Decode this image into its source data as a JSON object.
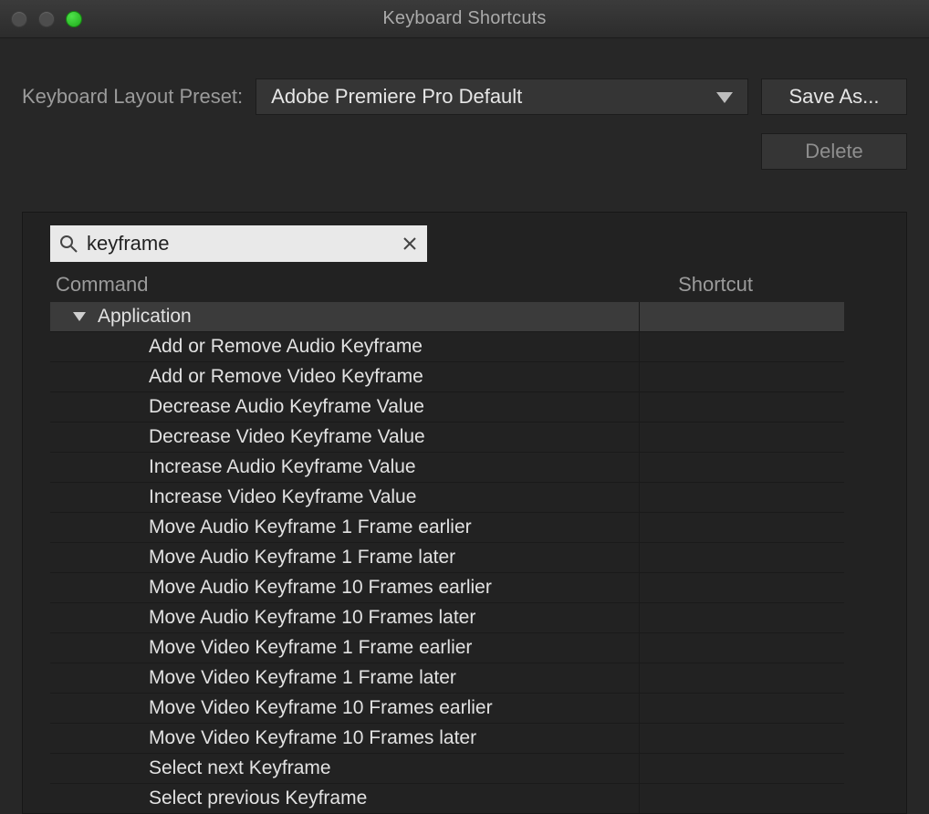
{
  "window": {
    "title": "Keyboard Shortcuts"
  },
  "preset": {
    "label": "Keyboard Layout Preset:",
    "value": "Adobe Premiere Pro Default",
    "save_as": "Save As...",
    "delete": "Delete"
  },
  "search": {
    "value": "keyframe"
  },
  "headers": {
    "command": "Command",
    "shortcut": "Shortcut"
  },
  "table": {
    "group": "Application",
    "items": [
      "Add or Remove Audio Keyframe",
      "Add or Remove Video Keyframe",
      "Decrease Audio Keyframe Value",
      "Decrease Video Keyframe Value",
      "Increase Audio Keyframe Value",
      "Increase Video Keyframe Value",
      "Move Audio Keyframe 1 Frame earlier",
      "Move Audio Keyframe 1 Frame later",
      "Move Audio Keyframe 10 Frames earlier",
      "Move Audio Keyframe 10 Frames later",
      "Move Video Keyframe 1 Frame earlier",
      "Move Video Keyframe 1 Frame later",
      "Move Video Keyframe 10 Frames earlier",
      "Move Video Keyframe 10 Frames later",
      "Select next Keyframe",
      "Select previous Keyframe"
    ]
  }
}
